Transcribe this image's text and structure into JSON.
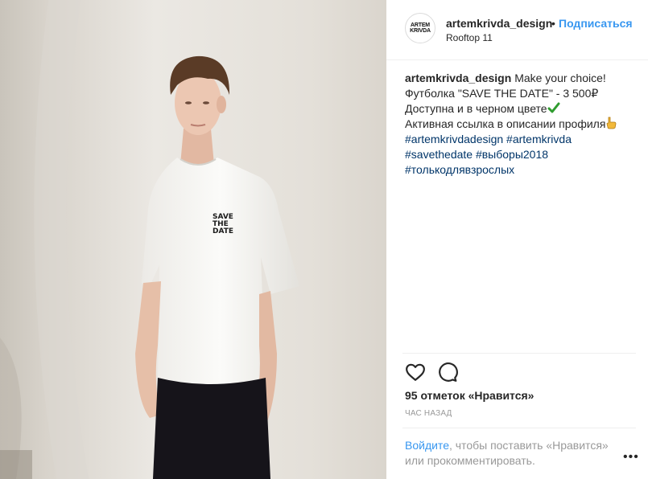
{
  "post": {
    "image_alt": "Man in white T-shirt with SAVE THE DATE print",
    "shirt_print": [
      "SAVE",
      "THE",
      "DATE"
    ]
  },
  "header": {
    "avatar_text": [
      "ARTEM",
      "KRIVDA"
    ],
    "username": "artemkrivda_design",
    "dot": "•",
    "follow_label": "Подписаться",
    "location": "Rooftop 11"
  },
  "caption": {
    "username": "artemkrivda_design",
    "line1": "Make your choice!",
    "line2": "Футболка \"SAVE THE DATE\" - 3 500₽",
    "line3": "Доступна и в черном цвете",
    "line4": "Активная ссылка в описании профиля",
    "hashtags_row1": "#artemkrivdadesign #artemkrivda",
    "hashtags_row2": "#savethedate #выборы2018",
    "hashtags_row3": "#толькодлявзрослых"
  },
  "actions": {
    "like_icon": "heart-icon",
    "comment_icon": "comment-icon"
  },
  "likes_text": "95 отметок «Нравится»",
  "time_text": "час назад",
  "login": {
    "link": "Войдите",
    "text": ", чтобы поставить «Нравится» или прокомментировать."
  },
  "more_label": "•••",
  "colors": {
    "accent": "#3897f0",
    "hashtag": "#003569",
    "text": "#262626",
    "muted": "#999999"
  }
}
